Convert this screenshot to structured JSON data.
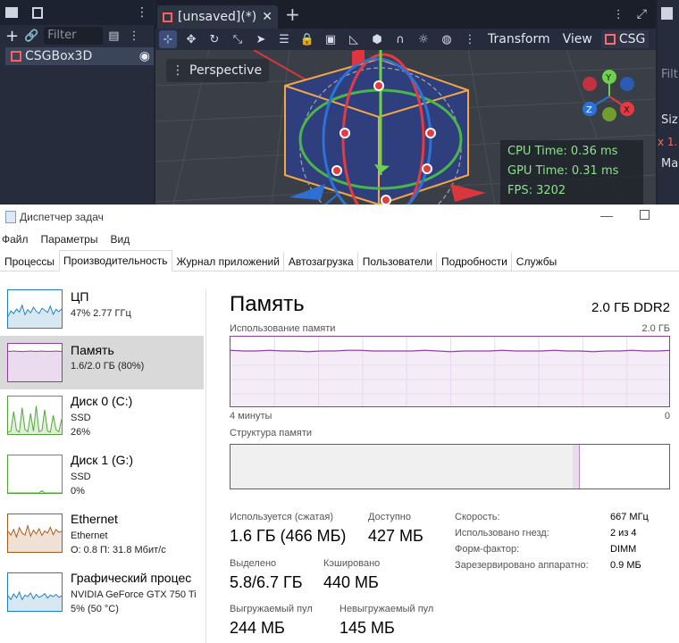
{
  "godot": {
    "scene_dock": {
      "filter_placeholder": "Filter",
      "node_name": "CSGBox3D"
    },
    "tab_label": "[unsaved](*)",
    "add_tab_symbol": "+",
    "toolbar": {
      "transform": "Transform",
      "view": "View",
      "csg": "CSG"
    },
    "viewport": {
      "perspective_label": "Perspective",
      "cpu_time": "CPU Time: 0.36 ms",
      "gpu_time": "GPU Time: 0.31 ms",
      "fps": "FPS: 3202"
    },
    "gizmo_labels": {
      "y": "Y",
      "z": "Z",
      "x": "X"
    },
    "inspector_glimpse": {
      "filter": "Filt",
      "size": "Siz",
      "x": "x  1.",
      "ma": "Ma"
    },
    "colors": {
      "bg": "#202531",
      "accent": "#3a4e78",
      "stats_text": "#8ee28e"
    }
  },
  "taskmgr": {
    "title": "Диспетчер задач",
    "menu": [
      "Файл",
      "Параметры",
      "Вид"
    ],
    "tabs": [
      "Процессы",
      "Производительность",
      "Журнал приложений",
      "Автозагрузка",
      "Пользователи",
      "Подробности",
      "Службы"
    ],
    "active_tab": "Производительность",
    "sidebar": [
      {
        "title": "ЦП",
        "line1": "47%  2.77 ГГц",
        "line2": "",
        "color": "#1f7fbf"
      },
      {
        "title": "Память",
        "line1": "1.6/2.0 ГБ (80%)",
        "line2": "",
        "color": "#8b3fa3"
      },
      {
        "title": "Диск 0 (C:)",
        "line1": "SSD",
        "line2": "26%",
        "color": "#4da632"
      },
      {
        "title": "Диск 1 (G:)",
        "line1": "SSD",
        "line2": "0%",
        "color": "#4da632"
      },
      {
        "title": "Ethernet",
        "line1": "Ethernet",
        "line2": "О: 0.8  П: 31.8 Мбит/с",
        "color": "#a85a16"
      },
      {
        "title": "Графический процес",
        "line1": "NVIDIA GeForce GTX 750 Ti",
        "line2": "5%  (50 °C)",
        "color": "#1f7fbf"
      }
    ],
    "memory": {
      "heading": "Память",
      "type": "2.0 ГБ DDR2",
      "usage_label": "Использование памяти",
      "usage_max": "2.0 ГБ",
      "time_left": "4 минуты",
      "time_right": "0",
      "structure_label": "Структура памяти",
      "structure_in_use_fraction": 0.78,
      "structure_modified_fraction": 0.015,
      "usage_history_percent": [
        81,
        80,
        80,
        81,
        80,
        80,
        79,
        80,
        80,
        81,
        81,
        80,
        80,
        80,
        80,
        81,
        80,
        79,
        80,
        80,
        80,
        81,
        80,
        80,
        80,
        81,
        80,
        80,
        79,
        80,
        80,
        81,
        80,
        80,
        81
      ],
      "stats": [
        {
          "label": "Используется (сжатая)",
          "value": "1.6 ГБ (466 МБ)"
        },
        {
          "label": "Доступно",
          "value": "427 МБ"
        },
        {
          "label": "Выделено",
          "value": "5.8/6.7 ГБ"
        },
        {
          "label": "Кэшировано",
          "value": "440 МБ"
        },
        {
          "label": "Выгружаемый пул",
          "value": "244 МБ"
        },
        {
          "label": "Невыгружаемый пул",
          "value": "145 МБ"
        }
      ],
      "details": [
        {
          "label": "Скорость:",
          "value": "667 МГц"
        },
        {
          "label": "Использовано гнезд:",
          "value": "2 из 4"
        },
        {
          "label": "Форм-фактор:",
          "value": "DIMM"
        },
        {
          "label": "Зарезервировано аппаратно:",
          "value": "0.9 МБ"
        }
      ]
    },
    "sidebar_history": {
      "cpu": [
        30,
        45,
        38,
        50,
        42,
        60,
        35,
        48,
        40,
        55,
        44,
        38,
        52,
        47,
        41,
        58,
        36,
        49,
        43,
        50
      ],
      "memory": [
        80,
        80,
        81,
        80,
        80,
        79,
        80,
        80,
        81,
        80,
        80,
        80,
        81,
        80,
        80,
        80,
        80,
        81,
        80,
        80
      ],
      "disk0": [
        5,
        8,
        60,
        10,
        5,
        70,
        12,
        6,
        55,
        8,
        75,
        6,
        10,
        65,
        8,
        5,
        50,
        12,
        6,
        40
      ],
      "disk1": [
        0,
        0,
        0,
        0,
        0,
        0,
        0,
        0,
        0,
        0,
        0,
        0,
        6,
        0,
        0,
        0,
        0,
        0,
        0,
        0
      ],
      "ethernet": [
        55,
        45,
        60,
        40,
        65,
        50,
        45,
        70,
        42,
        58,
        48,
        62,
        44,
        56,
        50,
        66,
        46,
        60,
        52,
        55
      ],
      "gpu": [
        40,
        30,
        45,
        35,
        50,
        30,
        42,
        38,
        48,
        32,
        44,
        36,
        40,
        46,
        34,
        42,
        38,
        44,
        36,
        40
      ]
    }
  }
}
